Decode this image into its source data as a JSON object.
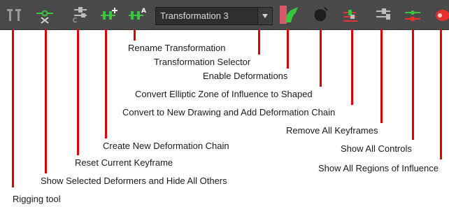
{
  "toolbar": {
    "selector_value": "Transformation 3",
    "icons": [
      "rigging-tool-icon",
      "show-selected-deformers-icon",
      "reset-current-keyframe-icon",
      "create-deformation-chain-icon",
      "rename-transformation-icon",
      "transformation-selector-dropdown",
      "enable-deformations-icon",
      "convert-elliptic-zone-icon",
      "convert-new-drawing-icon",
      "remove-all-keyframes-icon",
      "show-all-controls-icon",
      "show-all-regions-icon"
    ]
  },
  "labels": {
    "rigging_tool": "Rigging tool",
    "show_selected": "Show Selected Deformers and Hide All Others",
    "reset_keyframe": "Reset Current Keyframe",
    "create_chain": "Create New Deformation Chain",
    "rename": "Rename Transformation",
    "selector": "Transformation Selector",
    "enable": "Enable Deformations",
    "convert_elliptic": "Convert Elliptic Zone of Influence to Shaped",
    "convert_new_drawing": "Convert to New Drawing and Add Deformation Chain",
    "remove_keyframes": "Remove All Keyframes",
    "show_controls": "Show All Controls",
    "show_regions": "Show All Regions of Influence"
  },
  "colors": {
    "toolbar_bg": "#4a4a4a",
    "callout": "#e00000",
    "icon_green": "#3cc43c",
    "icon_red": "#e83030"
  }
}
